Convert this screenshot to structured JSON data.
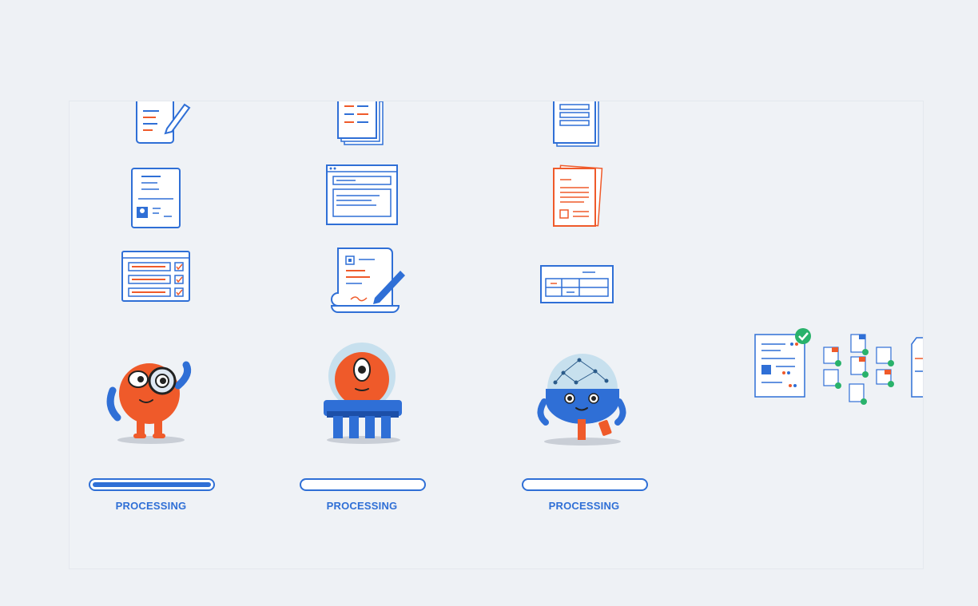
{
  "stages": [
    {
      "label": "PROCESSING",
      "progress": 1.0,
      "robot": "magnifier-robot"
    },
    {
      "label": "PROCESSING",
      "progress": 0.0,
      "robot": "cyclops-robot"
    },
    {
      "label": "PROCESSING",
      "progress": 0.0,
      "robot": "brain-robot"
    }
  ],
  "colors": {
    "accent": "#2f6fd6",
    "orange": "#ef5a2a",
    "check": "#29b26b"
  }
}
